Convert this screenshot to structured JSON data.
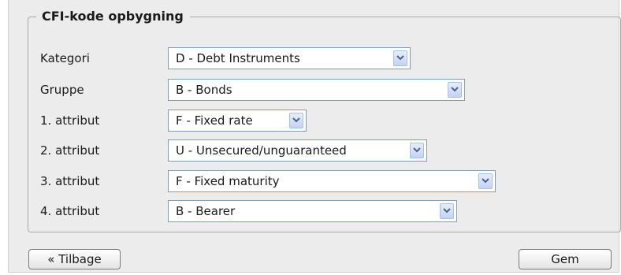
{
  "fieldset": {
    "legend": "CFI-kode opbygning",
    "rows": [
      {
        "label": "Kategori",
        "value": "D - Debt Instruments"
      },
      {
        "label": "Gruppe",
        "value": "B - Bonds"
      },
      {
        "label": "1. attribut",
        "value": "F - Fixed rate"
      },
      {
        "label": "2. attribut",
        "value": "U - Unsecured/unguaranteed"
      },
      {
        "label": "3. attribut",
        "value": "F - Fixed maturity"
      },
      {
        "label": "4. attribut",
        "value": "B - Bearer"
      }
    ]
  },
  "buttons": {
    "back_label": "« Tilbage",
    "save_label": "Gem"
  },
  "icons": {
    "dropdown": "chevron-down-icon"
  },
  "colors": {
    "panel_background": "#ececec",
    "select_border": "#7f9db9",
    "dropdown_arrow": "#4d6185"
  }
}
